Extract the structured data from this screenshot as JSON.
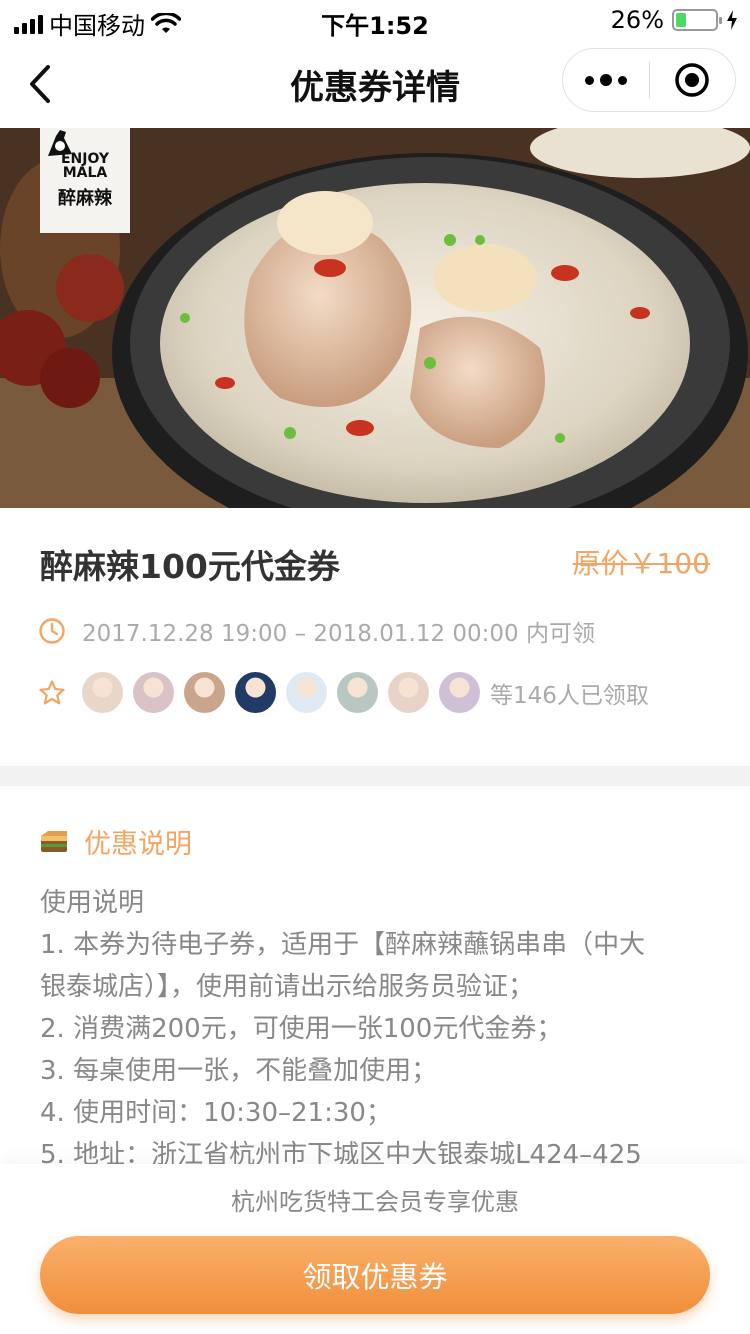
{
  "status_bar": {
    "carrier": "中国移动",
    "time": "下午1:52",
    "battery": "26%",
    "battery_level": 0.26,
    "icons": [
      "signal-icon",
      "wifi-icon",
      "battery-icon",
      "charging-icon"
    ]
  },
  "nav": {
    "title": "优惠券详情",
    "icons": [
      "back-icon",
      "more-icon",
      "close-icon"
    ]
  },
  "hero": {
    "logo_text_en_1": "ENJOY",
    "logo_text_en_2": "MALA",
    "logo_text_cn": "醉麻辣"
  },
  "coupon": {
    "title": "醉麻辣100元代金券",
    "original_price": "原价￥100",
    "validity": "2017.12.28 19:00 – 2018.01.12 00:00 内可领",
    "claimed_text": "等146人已领取",
    "avatar_colors": [
      "#e8d6c8",
      "#d9c3c6",
      "#c8a58b",
      "#223a66",
      "#dfe9f4",
      "#b9c7c2",
      "#e9d3c9",
      "#cfc0d8"
    ]
  },
  "description": {
    "heading": "优惠说明",
    "lines": [
      "使用说明",
      "1. 本券为待电子券，适用于【醉麻辣蘸锅串串（中大",
      "银泰城店）】，使用前请出示给服务员验证；",
      "2. 消费满200元，可使用一张100元代金券；",
      "3. 每桌使用一张，不能叠加使用；",
      "4. 使用时间：10:30–21:30；",
      "5. 地址：浙江省杭州市下城区中大银泰城L424–425"
    ]
  },
  "bottom": {
    "note": "杭州吃货特工会员专享优惠",
    "button": "领取优惠券"
  },
  "colors": {
    "accent": "#f3a563",
    "button_top": "#f9b06a",
    "button_bottom": "#f08f3c",
    "muted_text": "#aaaaaa",
    "battery_green": "#4cd964"
  }
}
